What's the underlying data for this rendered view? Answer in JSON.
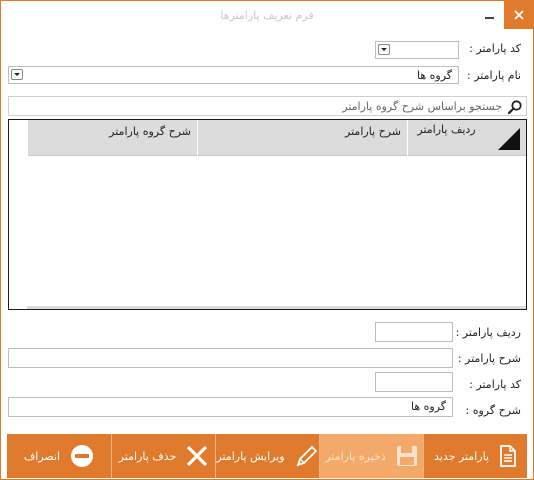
{
  "window": {
    "title": "فرم تعریف پارامترها",
    "close_glyph": "✕"
  },
  "top_form": {
    "param_code_label": "کد پارامتر :",
    "param_name_label": "نام پارامتر :",
    "param_name_value": "گروه ها"
  },
  "search": {
    "text": "جستجو براساس شرح گروه پارامتر",
    "icon": "search-icon"
  },
  "grid": {
    "columns": [
      "ردیف پارامتر",
      "شرح پارامتر",
      "شرح گروه پارامتر"
    ],
    "rows": []
  },
  "bottom_form": {
    "row_label": "ردیف پارامتر :",
    "desc_label": "شرح پارامتر :",
    "code_label": "کد پارامتر :",
    "group_desc_label": "شرح گروه :",
    "group_desc_value": "گروه ها"
  },
  "footer": {
    "new_label": "پارامتر جدید",
    "save_label": "ذخیره پارامتر",
    "edit_label": "ویرایش پارامتر",
    "delete_label": "حذف پارامتر",
    "cancel_label": "انصراف"
  },
  "colors": {
    "accent": "#e07a2c",
    "disabled": "#f2a96a"
  }
}
